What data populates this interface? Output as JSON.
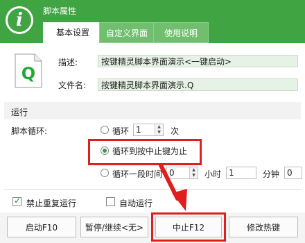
{
  "window": {
    "title": "脚本属性",
    "logo_glyph": "i"
  },
  "tabs": [
    {
      "label": "基本设置",
      "active": true
    },
    {
      "label": "自定义界面",
      "active": false
    },
    {
      "label": "使用说明",
      "active": false
    }
  ],
  "icon": {
    "name": "q-script-file-icon",
    "letter": "Q"
  },
  "fields": {
    "description_label": "描述:",
    "description_value": "按键精灵脚本界面演示<一键启动>",
    "filename_label": "文件名:",
    "filename_value": "按键精灵脚本界面演示.Q"
  },
  "run": {
    "section_title": "运行",
    "loop_label": "脚本循环:",
    "option_loop": {
      "label": "循环",
      "count": "1",
      "unit": "次",
      "selected": false
    },
    "option_until_stop": {
      "label": "循环到按中止键为止",
      "selected": true
    },
    "option_period": {
      "label": "循环一段时间",
      "hours": "0",
      "hours_unit": "小时",
      "minutes": "1",
      "minutes_unit": "分钟",
      "seconds": "0",
      "selected": false
    }
  },
  "checks": {
    "no_repeat": {
      "label": "禁止重复运行",
      "checked": true
    },
    "auto_run": {
      "label": "自动运行",
      "checked": false
    }
  },
  "buttons": {
    "start": "启动F10",
    "pause": "暂停/继续<无>",
    "stop": "中止F12",
    "hotkey": "修改热键"
  },
  "colors": {
    "header_green": "#3fa441",
    "field_green": "#e6f2e6",
    "highlight_red": "#e01e1e"
  }
}
